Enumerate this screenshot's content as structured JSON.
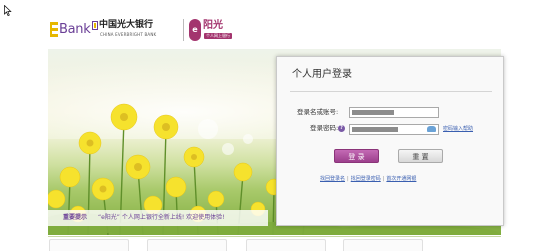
{
  "header": {
    "ebank_logo": "Bank",
    "bank_name_cn": "中国光大银行",
    "bank_name_en": "CHINA EVERBRIGHT BANK",
    "brand_badge": "e",
    "brand_name": "阳光",
    "brand_subtitle": "个人网上银行"
  },
  "news": {
    "label": "重要提示",
    "text": "“e阳光” 个人网上银行全新上线! 欢迎使用体验!"
  },
  "login": {
    "title": "个人用户登录",
    "username_label": "登录名或账号:",
    "password_label": "登录密码:",
    "keyboard_link": "密码输入帮助",
    "login_button": "登 录",
    "reset_button": "重 置",
    "links": [
      "找回登录名",
      "找回登录密码",
      "首次开通网银"
    ]
  },
  "colors": {
    "brand_purple": "#a3356e",
    "link_blue": "#3a5fb0",
    "login_button": "#9c3f8c"
  },
  "icons": [
    "cursor-icon",
    "help-icon",
    "soft-keyboard-icon"
  ]
}
